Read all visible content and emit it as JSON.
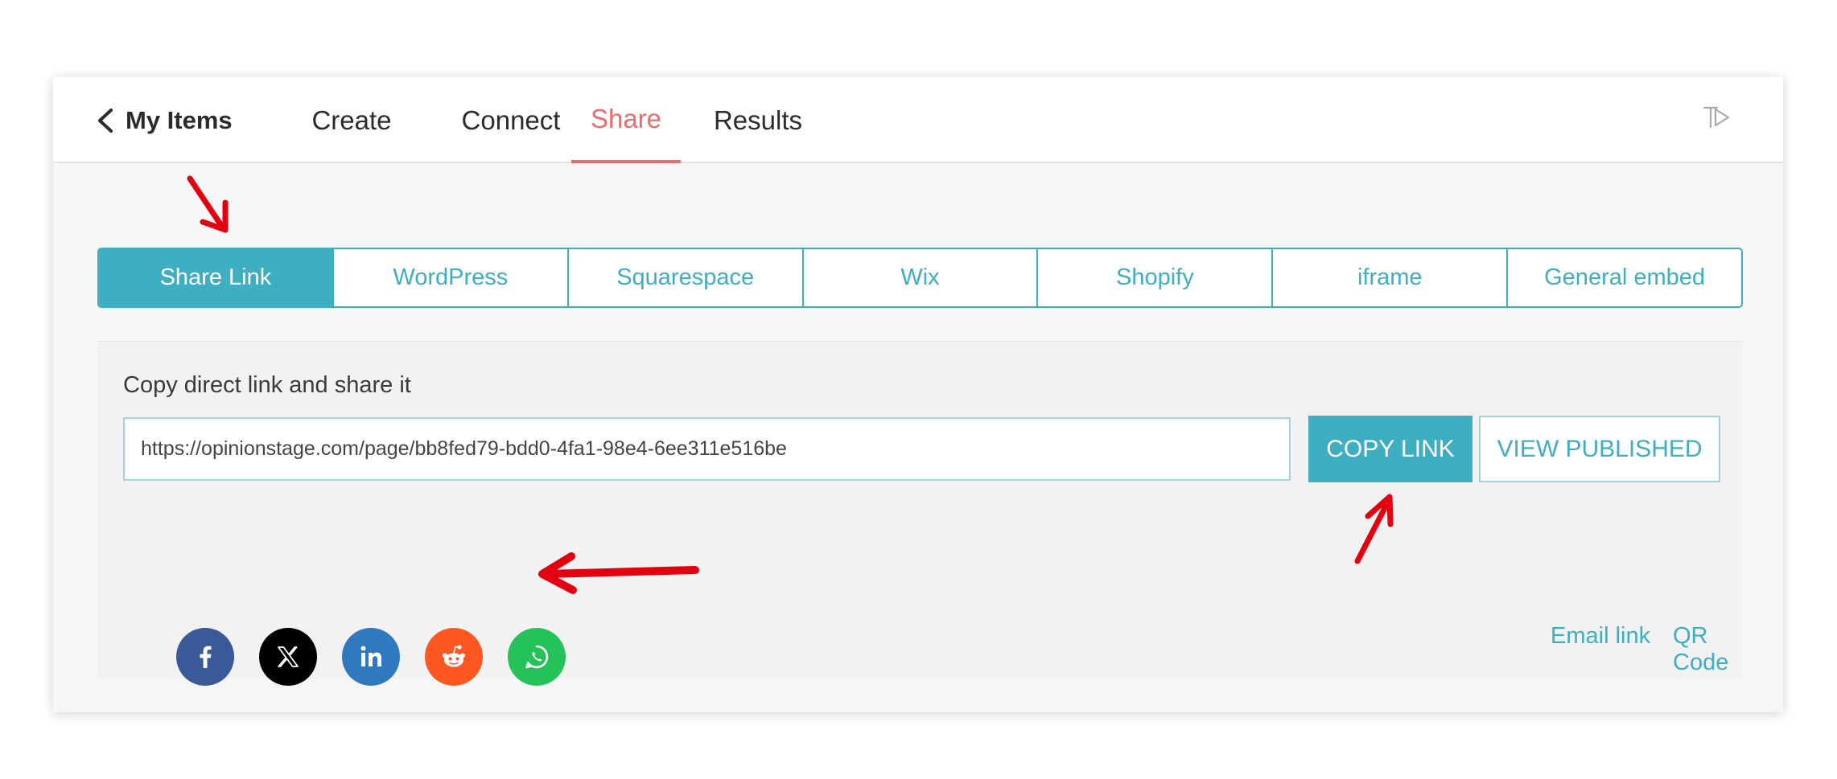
{
  "topnav": {
    "back_label": "My Items",
    "tabs": [
      {
        "label": "Create",
        "active": false
      },
      {
        "label": "Connect",
        "active": false
      },
      {
        "label": "Share",
        "active": true
      },
      {
        "label": "Results",
        "active": false
      }
    ]
  },
  "embed_tabs": [
    {
      "label": "Share Link",
      "active": true
    },
    {
      "label": "WordPress",
      "active": false
    },
    {
      "label": "Squarespace",
      "active": false
    },
    {
      "label": "Wix",
      "active": false
    },
    {
      "label": "Shopify",
      "active": false
    },
    {
      "label": "iframe",
      "active": false
    },
    {
      "label": "General embed",
      "active": false
    }
  ],
  "panel": {
    "label": "Copy direct link and share it",
    "link_value": "https://opinionstage.com/page/bb8fed79-bdd0-4fa1-98e4-6ee311e516be",
    "copy_button": "COPY LINK",
    "view_button": "VIEW PUBLISHED",
    "email_link": "Email link",
    "qr_code": "QR Code"
  },
  "social": [
    {
      "icon": "facebook-icon",
      "color": "#3b5998"
    },
    {
      "icon": "x-icon",
      "color": "#000000"
    },
    {
      "icon": "linkedin-icon",
      "color": "#2f79c0"
    },
    {
      "icon": "reddit-icon",
      "color": "#ff5722"
    },
    {
      "icon": "whatsapp-icon",
      "color": "#25c25a"
    }
  ],
  "colors": {
    "accent": "#3eaec1",
    "active_tab": "#ee6a6f",
    "annotation": "#e3000f"
  }
}
